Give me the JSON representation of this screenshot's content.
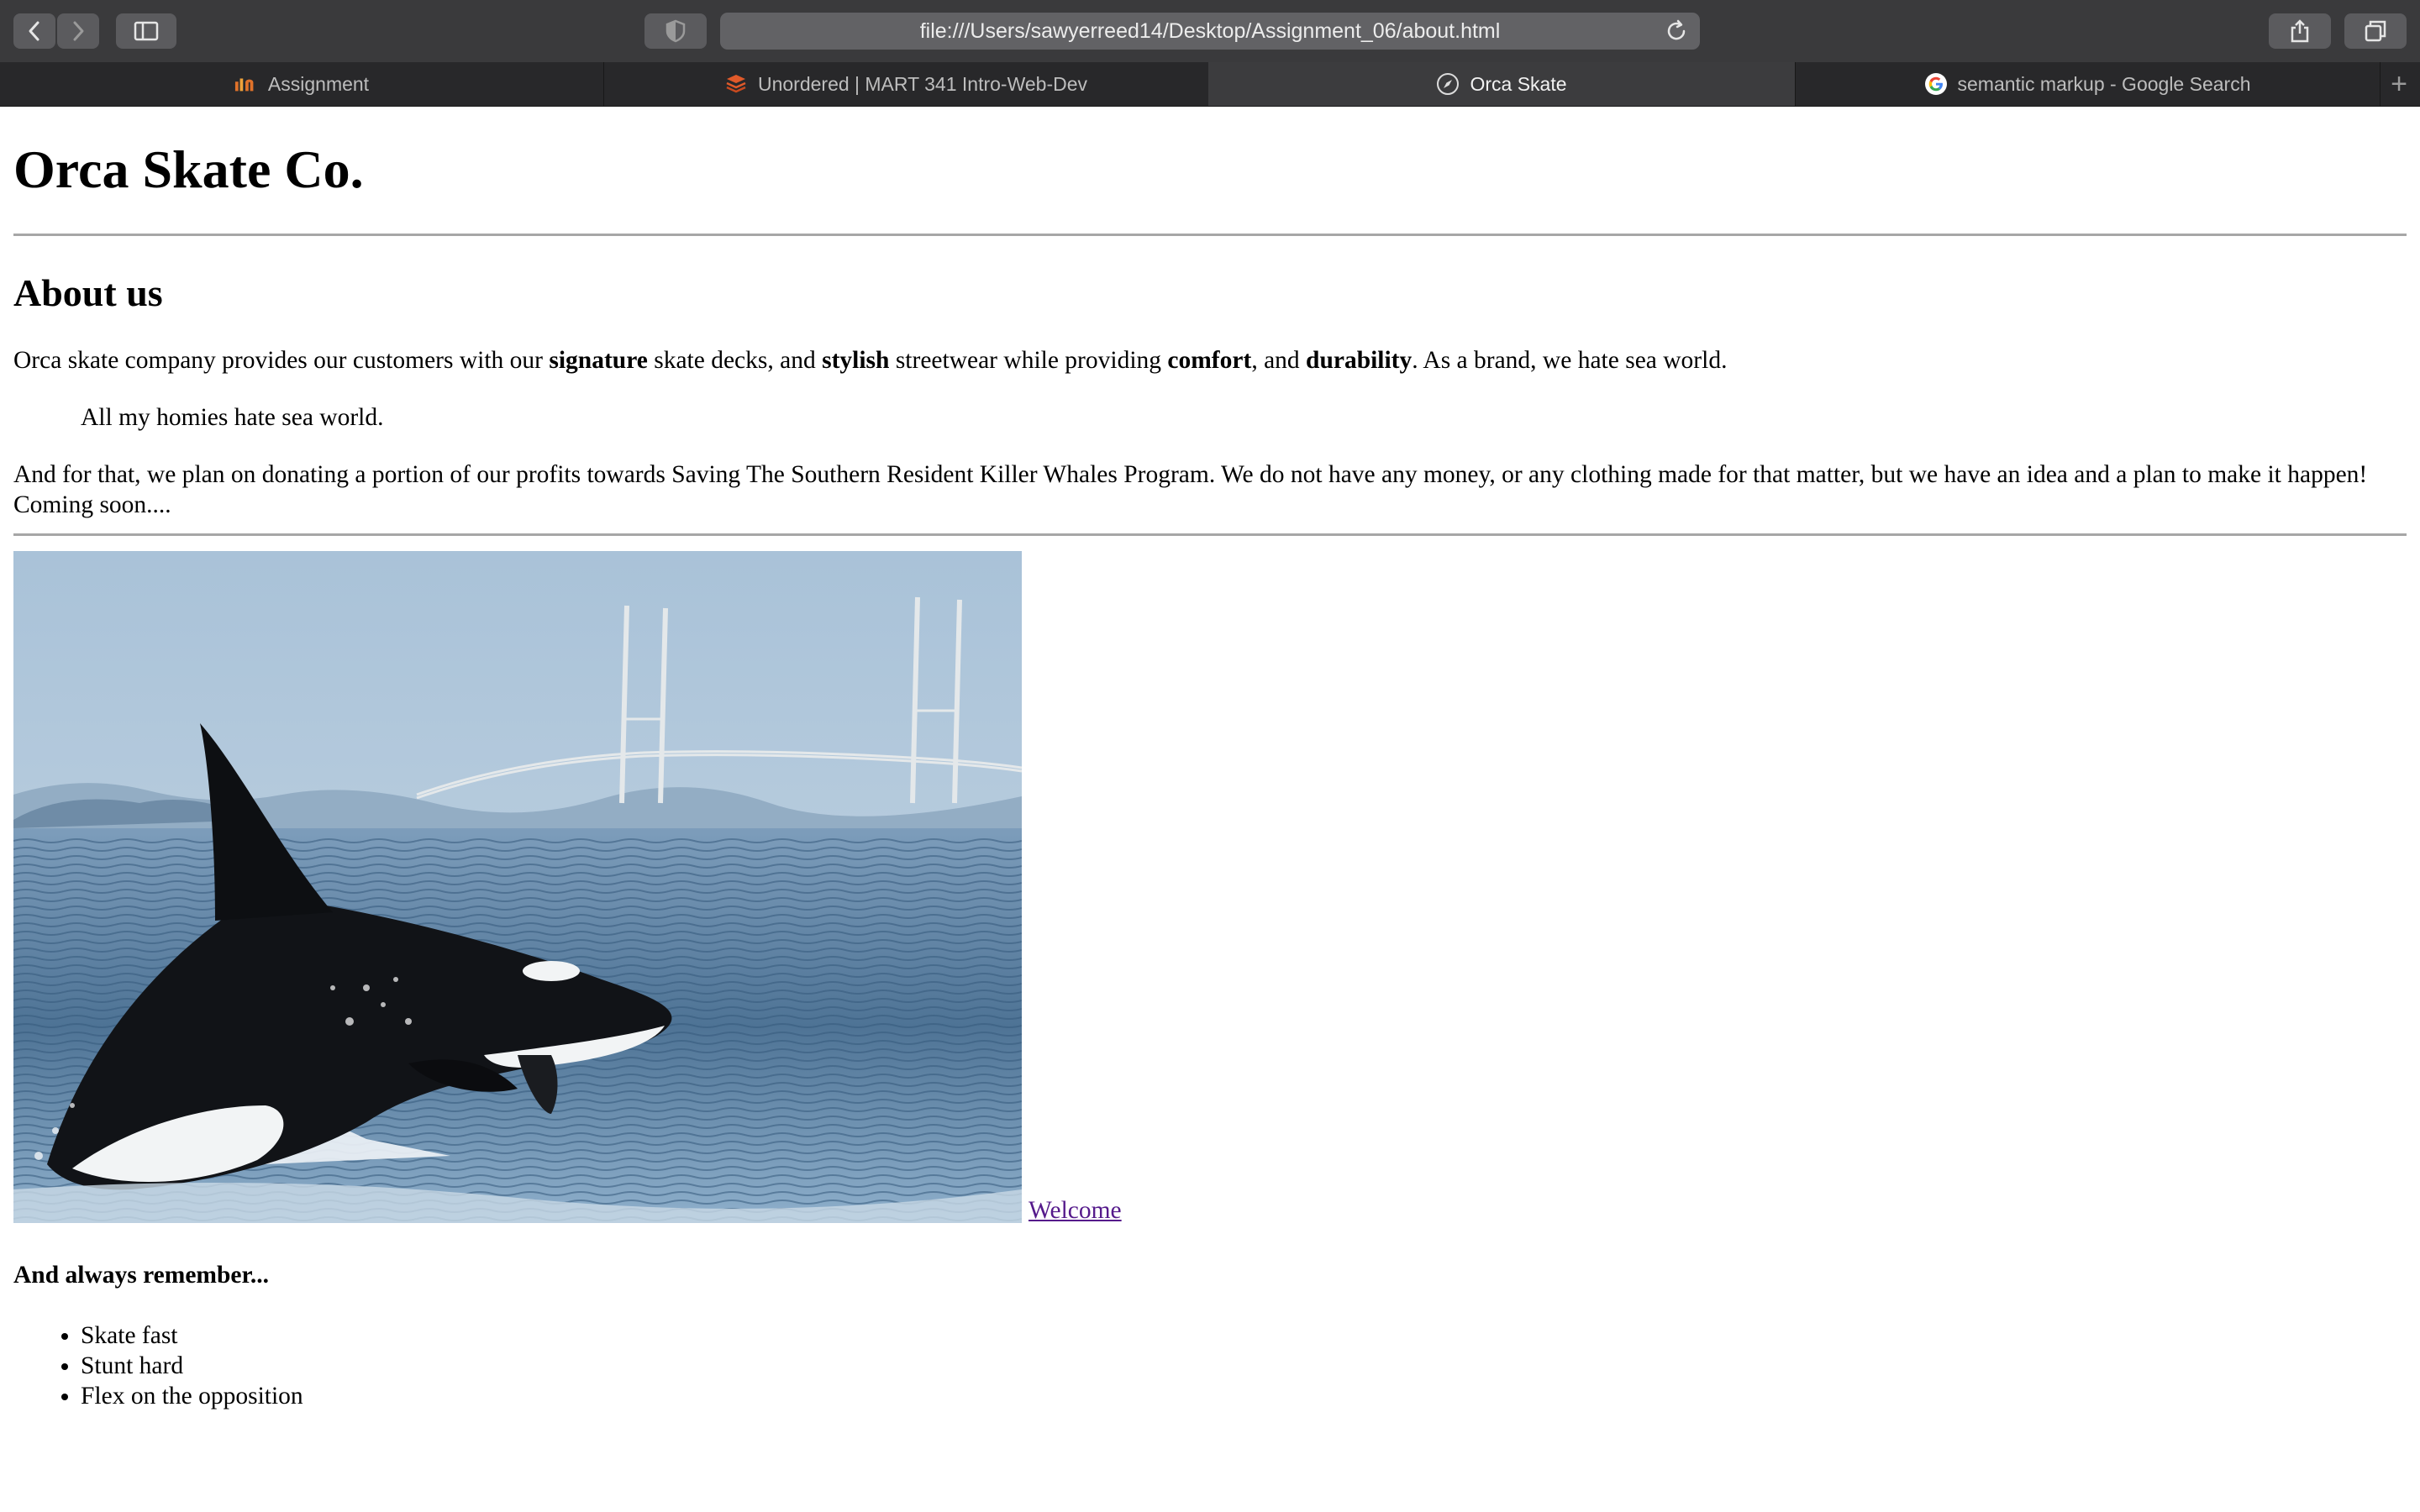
{
  "browser": {
    "url": "file:///Users/sawyerreed14/Desktop/Assignment_06/about.html",
    "tabs": [
      {
        "label": "Assignment",
        "icon": "instructure-icon"
      },
      {
        "label": "Unordered | MART 341 Intro-Web-Dev",
        "icon": "html-layers-icon"
      },
      {
        "label": "Orca Skate",
        "icon": "compass-icon",
        "active": true
      },
      {
        "label": "semantic markup - Google Search",
        "icon": "google-icon"
      }
    ],
    "new_tab_label": "+"
  },
  "page": {
    "title": "Orca Skate Co.",
    "section_heading": "About us",
    "intro": {
      "t1": "Orca skate company provides our customers with our ",
      "b1": "signature",
      "t2": " skate decks, and ",
      "b2": "stylish",
      "t3": " streetwear while providing ",
      "b3": "comfort",
      "t4": ", and ",
      "b4": "durability",
      "t5": ". As a brand, we hate sea world."
    },
    "quote": "All my homies hate sea world.",
    "mission": "And for that, we plan on donating a portion of our profits towards Saving The Southern Resident Killer Whales Program. We do not have any money, or any clothing made for that matter, but we have an idea and a plan to make it happen! Coming soon....",
    "welcome_link": "Welcome",
    "remember_heading": "And always remember...",
    "list": [
      "Skate fast",
      "Stunt hard",
      "Flex on the opposition"
    ]
  }
}
